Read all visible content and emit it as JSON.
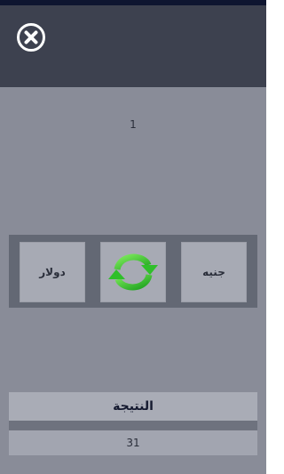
{
  "header": {
    "close_icon": "close-circle-icon"
  },
  "amount": {
    "value": "1"
  },
  "converter": {
    "from_currency": "دولار",
    "to_currency": "جنيه",
    "swap_icon": "refresh-arrows-icon"
  },
  "result": {
    "label": "النتيجة",
    "value": "31"
  },
  "colors": {
    "header_bg": "#3d414f",
    "main_bg": "#898c98",
    "button_bg": "#a7aab4",
    "swap_green": "#2fbf2a"
  }
}
